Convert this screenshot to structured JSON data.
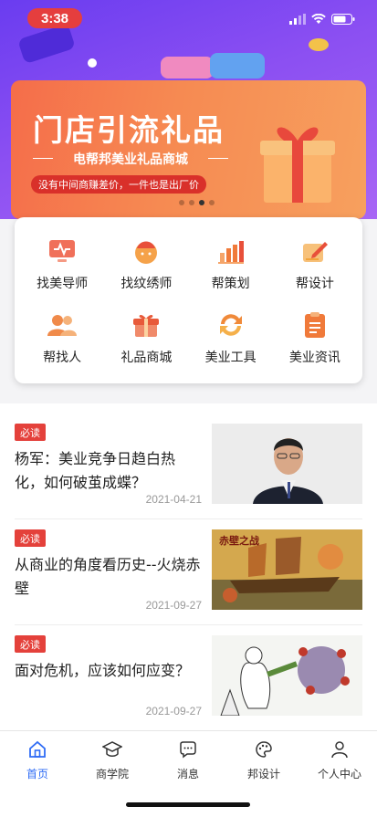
{
  "status_bar": {
    "time": "3:38"
  },
  "banner": {
    "title": "门店引流礼品",
    "subtitle": "电帮邦美业礼品商城",
    "tagline": "没有中间商赚差价，一件也是出厂价",
    "dots": 4,
    "active_dot": 2
  },
  "categories": [
    {
      "label": "找美导师",
      "icon": "monitor-icon",
      "color": "#f0705a"
    },
    {
      "label": "找纹绣师",
      "icon": "user-hat-icon",
      "color": "#f5a24a"
    },
    {
      "label": "帮策划",
      "icon": "bar-chart-icon",
      "color": "#f07a3a"
    },
    {
      "label": "帮设计",
      "icon": "pen-icon",
      "color": "#f2a33a"
    },
    {
      "label": "帮找人",
      "icon": "people-icon",
      "color": "#f08a4a"
    },
    {
      "label": "礼品商城",
      "icon": "gift-box-icon",
      "color": "#e85a3a"
    },
    {
      "label": "美业工具",
      "icon": "refresh-arrows-icon",
      "color": "#f08a3a"
    },
    {
      "label": "美业资讯",
      "icon": "document-icon",
      "color": "#f07a3a"
    }
  ],
  "news": [
    {
      "badge": "必读",
      "title": "杨军：美业竞争日趋白热化，如何破茧成蝶？",
      "date": "2021-04-21",
      "thumb": "portrait"
    },
    {
      "badge": "必读",
      "title": "从商业的角度看历史--火烧赤壁",
      "date": "2021-09-27",
      "thumb": "battle",
      "thumb_text": "赤壁之战"
    },
    {
      "badge": "必读",
      "title": "面对危机，应该如何应变？",
      "date": "2021-09-27",
      "thumb": "cartoon"
    }
  ],
  "tabbar": {
    "tabs": [
      {
        "label": "首页",
        "icon": "home-icon",
        "active": true
      },
      {
        "label": "商学院",
        "icon": "graduation-cap-icon",
        "active": false
      },
      {
        "label": "消息",
        "icon": "chat-bubble-icon",
        "active": false
      },
      {
        "label": "邦设计",
        "icon": "palette-icon",
        "active": false
      },
      {
        "label": "个人中心",
        "icon": "person-icon",
        "active": false
      }
    ]
  },
  "colors": {
    "accent": "#2f6cf5",
    "badge": "#e4413b",
    "header_purple": "#7a45f1"
  }
}
